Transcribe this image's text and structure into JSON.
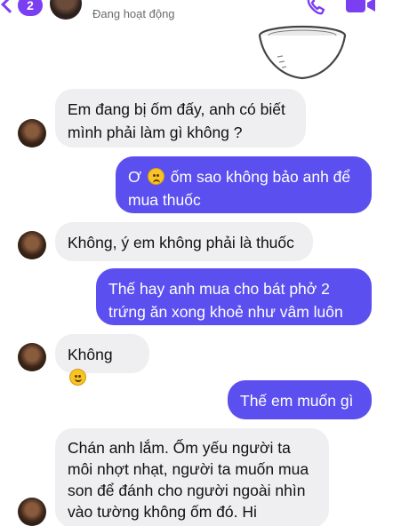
{
  "header": {
    "back_badge": "2",
    "status": "Đang hoạt động",
    "call_icon": "phone-icon",
    "video_icon": "video-call-icon"
  },
  "colors": {
    "accent": "#7b3ff2",
    "outgoing_bubble": "#5b4ff0",
    "incoming_bubble": "#efeff1"
  },
  "messages": [
    {
      "side": "in",
      "lines": [
        "Em đang bị ốm đấy, anh có biết",
        "mình phải làm gì không ?"
      ]
    },
    {
      "side": "out",
      "before_emoji": "Ơ",
      "emoji": "disappointed-face",
      "after_emoji": "ốm sao không bảo anh để",
      "line2": "mua thuốc"
    },
    {
      "side": "in",
      "text": "Không, ý em không phải là thuốc"
    },
    {
      "side": "out",
      "lines": [
        "Thế hay anh mua cho bát phở 2",
        "trứng ăn xong khoẻ như vâm luôn"
      ]
    },
    {
      "side": "in",
      "text": "Không",
      "emoji": "slightly-smiling-face"
    },
    {
      "side": "out",
      "text": "Thế em muốn gì"
    },
    {
      "side": "in",
      "lines": [
        "Chán anh lắm. Ốm yếu người ta",
        "môi nhợt nhạt, người ta muốn mua",
        "son để đánh cho người ngoài nhìn",
        "vào tường không ốm đó. Hi"
      ]
    }
  ]
}
